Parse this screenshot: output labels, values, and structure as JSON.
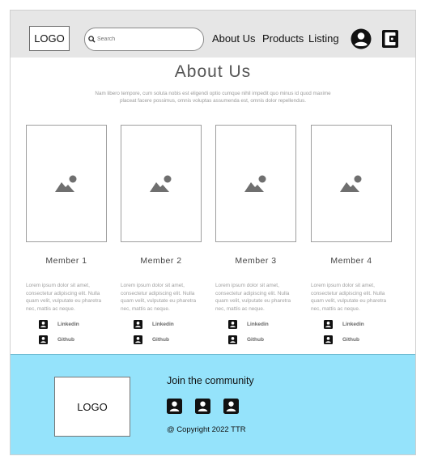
{
  "header": {
    "logo": "LOGO",
    "search_placeholder": "Search",
    "nav": [
      "About Us",
      "Products",
      "Listing"
    ],
    "icons": [
      "account-circle-icon",
      "wallet-icon"
    ]
  },
  "about": {
    "title": "About Us",
    "subtitle": "Nam libero tempore, cum soluta nobis est eligendi optio cumque nihil impedit quo minus id quod maxime placeat facere possimus, omnis voluptas assumenda est, omnis dolor repellendus."
  },
  "members": [
    {
      "name": "Member 1",
      "desc": "Lorem ipsum dolor sit amet, consectetur adipiscing elit. Nulla quam velit, vulputate eu pharetra nec, mattis ac neque.",
      "links": [
        "Linkedin",
        "Github"
      ]
    },
    {
      "name": "Member 2",
      "desc": "Lorem ipsum dolor sit amet, consectetur adipiscing elit. Nulla quam velit, vulputate eu pharetra nec, mattis ac neque.",
      "links": [
        "Linkedin",
        "Github"
      ]
    },
    {
      "name": "Member 3",
      "desc": "Lorem ipsum dolor sit amet, consectetur adipiscing elit. Nulla quam velit, vulputate eu pharetra nec, mattis ac neque.",
      "links": [
        "Linkedin",
        "Github"
      ]
    },
    {
      "name": "Member 4",
      "desc": "Lorem ipsum dolor sit amet, consectetur adipiscing elit. Nulla quam velit, vulputate eu pharetra nec, mattis ac neque.",
      "links": [
        "Linkedin",
        "Github"
      ]
    }
  ],
  "footer": {
    "logo": "LOGO",
    "join": "Join the community",
    "copyright": "@ Copyright 2022 TTR",
    "social_icons": [
      "account-box-icon",
      "account-box-icon",
      "account-box-icon"
    ]
  },
  "colors": {
    "header_bg": "#e6e6e6",
    "footer_bg": "#95e3fb"
  }
}
